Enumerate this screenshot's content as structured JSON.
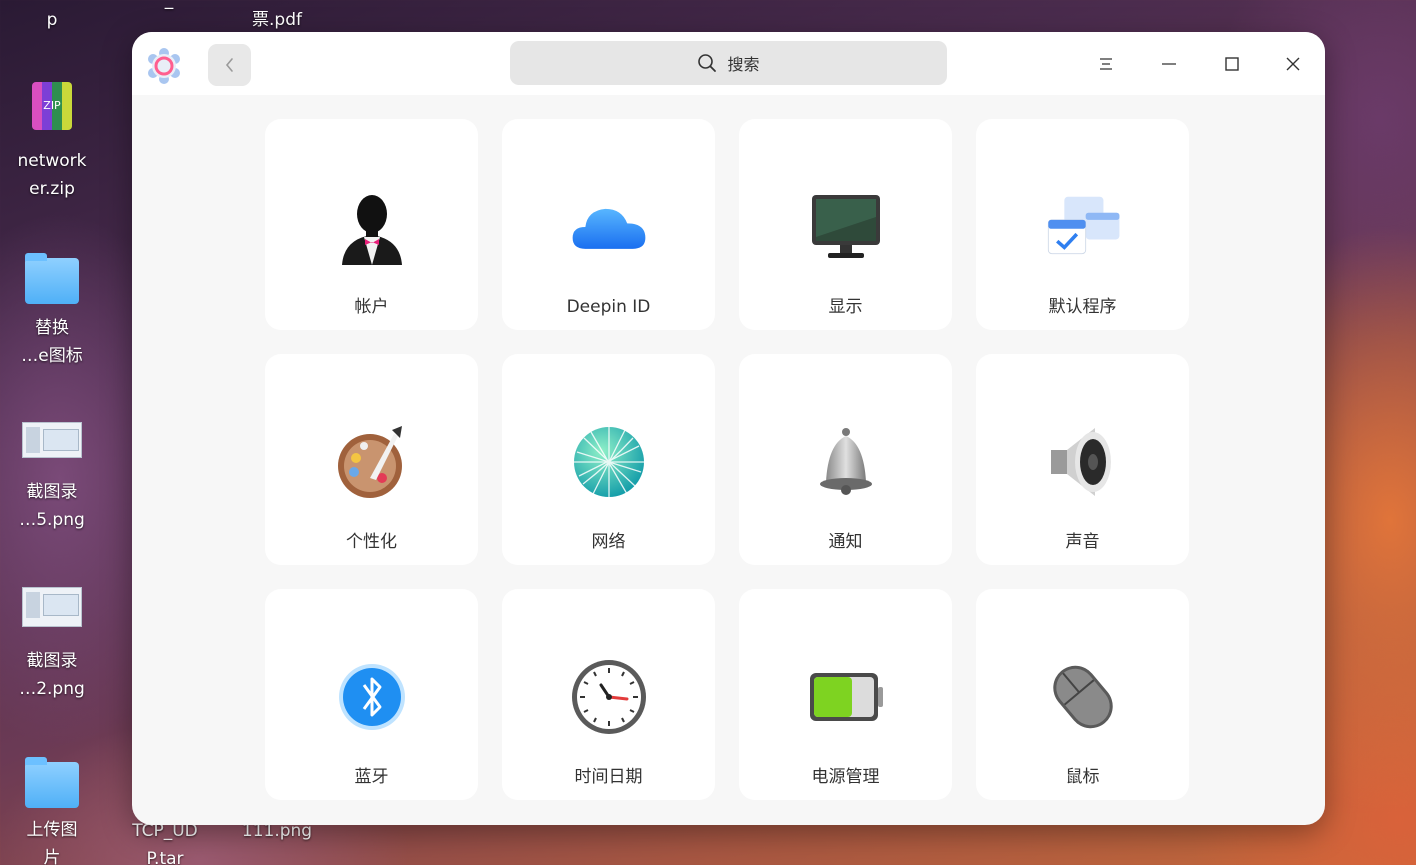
{
  "desktop": {
    "top_fragments": [
      {
        "label": "p"
      },
      {
        "label": "_"
      },
      {
        "label": "票.pdf"
      }
    ],
    "icons": [
      {
        "label": "network\ner.zip"
      },
      {
        "label": "替换\n…e图标"
      },
      {
        "label": "截图录\n…5.png"
      },
      {
        "label": "截图录\n…2.png"
      },
      {
        "label": "上传图\n片"
      },
      {
        "label": "TCP_UD\nP.tar"
      },
      {
        "label": "111.png"
      }
    ]
  },
  "window": {
    "search_placeholder": "搜索",
    "controls": {
      "menu": "menu-icon",
      "minimize": "minimize-icon",
      "maximize": "maximize-icon",
      "close": "close-icon"
    },
    "modules": [
      {
        "label": "帐户",
        "icon": "account-icon"
      },
      {
        "label": "Deepin ID",
        "icon": "cloud-icon"
      },
      {
        "label": "显示",
        "icon": "display-icon"
      },
      {
        "label": "默认程序",
        "icon": "default-apps-icon"
      },
      {
        "label": "个性化",
        "icon": "palette-icon"
      },
      {
        "label": "网络",
        "icon": "network-icon"
      },
      {
        "label": "通知",
        "icon": "bell-icon"
      },
      {
        "label": "声音",
        "icon": "speaker-icon"
      },
      {
        "label": "蓝牙",
        "icon": "bluetooth-icon"
      },
      {
        "label": "时间日期",
        "icon": "clock-icon"
      },
      {
        "label": "电源管理",
        "icon": "battery-icon"
      },
      {
        "label": "鼠标",
        "icon": "mouse-icon"
      }
    ]
  }
}
